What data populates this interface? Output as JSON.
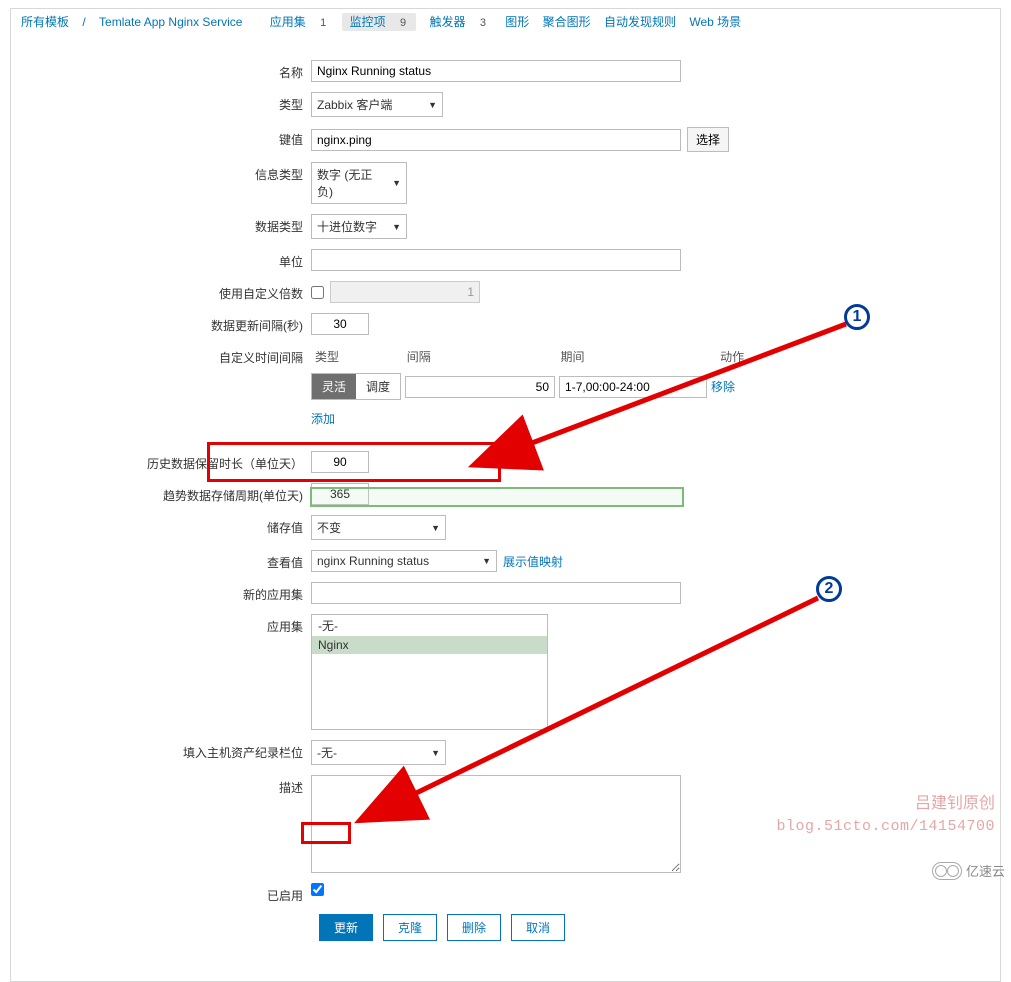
{
  "breadcrumb": {
    "all_templates": "所有模板",
    "template_name": "Temlate App Nginx Service"
  },
  "tabs": {
    "apps": {
      "label": "应用集",
      "count": "1"
    },
    "items": {
      "label": "监控项",
      "count": "9"
    },
    "triggers": {
      "label": "触发器",
      "count": "3"
    },
    "graphs": {
      "label": "图形"
    },
    "screens": {
      "label": "聚合图形"
    },
    "discovery": {
      "label": "自动发现规则"
    },
    "web": {
      "label": "Web 场景"
    }
  },
  "form": {
    "name_label": "名称",
    "name_value": "Nginx Running status",
    "type_label": "类型",
    "type_value": "Zabbix 客户端",
    "key_label": "键值",
    "key_value": "nginx.ping",
    "key_select": "选择",
    "info_label": "信息类型",
    "info_value": "数字 (无正负)",
    "data_label": "数据类型",
    "data_value": "十进位数字",
    "unit_label": "单位",
    "unit_value": "",
    "mult_label": "使用自定义倍数",
    "mult_checked": false,
    "mult_value": "1",
    "update_label": "数据更新间隔(秒)",
    "update_value": "30",
    "interval_label": "自定义时间间隔",
    "interval_hdr": {
      "type": "类型",
      "interval": "间隔",
      "period": "期间",
      "action": "动作"
    },
    "toggle_flex": "灵活",
    "toggle_sched": "调度",
    "interval_val": "50",
    "period_val": "1-7,00:00-24:00",
    "remove": "移除",
    "add": "添加",
    "history_label": "历史数据保留时长（单位天）",
    "history_value": "90",
    "trend_label": "趋势数据存储周期(单位天)",
    "trend_value": "365",
    "store_label": "储存值",
    "store_value": "不变",
    "view_label": "查看值",
    "view_value": "nginx Running status",
    "view_link": "展示值映射",
    "newapp_label": "新的应用集",
    "newapp_value": "",
    "apps_label": "应用集",
    "apps_list": {
      "none": "-无-",
      "nginx": "Nginx"
    },
    "inventory_label": "填入主机资产纪录栏位",
    "inventory_value": "-无-",
    "desc_label": "描述",
    "desc_value": "",
    "enabled_label": "已启用",
    "enabled_checked": true,
    "btn_update": "更新",
    "btn_clone": "克隆",
    "btn_delete": "删除",
    "btn_cancel": "取消"
  },
  "watermark": {
    "l1": "吕建钊原创",
    "l2": "blog.51cto.com/14154700"
  },
  "footer": {
    "brand": "亿速云"
  },
  "markers": {
    "m1": "1",
    "m2": "2"
  }
}
